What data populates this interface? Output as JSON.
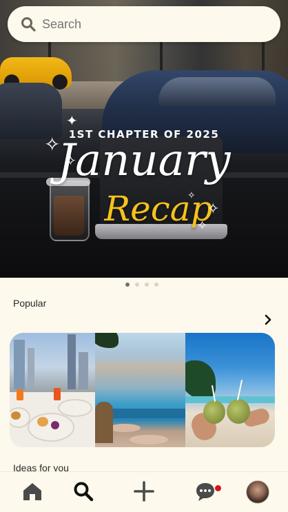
{
  "search": {
    "placeholder": "Search"
  },
  "hero": {
    "chapter_text": "1ST CHAPTER OF 2025",
    "title_main": "January",
    "title_sub": "Recap",
    "carousel_pages": 4,
    "carousel_active_index": 0
  },
  "sections": {
    "popular_title": "Popular",
    "ideas_title": "Ideas for you"
  },
  "nav": {
    "items": [
      {
        "name": "home",
        "icon": "home-icon"
      },
      {
        "name": "search",
        "icon": "search-icon",
        "active": true
      },
      {
        "name": "create",
        "icon": "plus-icon"
      },
      {
        "name": "messages",
        "icon": "chat-bubble-icon",
        "has_badge": true
      },
      {
        "name": "profile",
        "icon": "avatar"
      }
    ]
  },
  "colors": {
    "background": "#fdf9ec",
    "accent_yellow": "#f5c21b",
    "badge_red": "#d3121d",
    "text_dark": "#2a2a2a"
  }
}
